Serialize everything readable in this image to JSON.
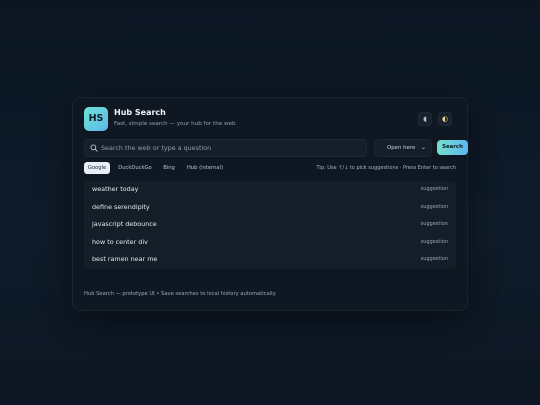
{
  "app": {
    "logo": "HS",
    "title": "Hub Search",
    "subtitle": "Fast, simple search — your hub for the web",
    "theme_buttons": [
      {
        "icon": "moon-icon",
        "glyph": "◖"
      },
      {
        "icon": "half-moon-icon",
        "glyph": "◐"
      }
    ]
  },
  "search": {
    "placeholder": "Search the web or type a question",
    "value": "",
    "open_mode": "Open here",
    "button_label": "Search"
  },
  "engines": [
    {
      "label": "Google",
      "active": true
    },
    {
      "label": "DuckDuckGo",
      "active": false
    },
    {
      "label": "Bing",
      "active": false
    },
    {
      "label": "Hub (internal)",
      "active": false
    }
  ],
  "tip": "Tip: Use ↑/↓ to pick suggestions · Press Enter to search",
  "suggestions": [
    {
      "text": "weather today",
      "tag": "suggestion"
    },
    {
      "text": "define serendipity",
      "tag": "suggestion"
    },
    {
      "text": "javascript debounce",
      "tag": "suggestion"
    },
    {
      "text": "how to center div",
      "tag": "suggestion"
    },
    {
      "text": "best ramen near me",
      "tag": "suggestion"
    }
  ],
  "footer": "Hub Search — prototype UI • Save searches to local history automatically.",
  "colors": {
    "background": "#0d1724",
    "card": "#0f1822",
    "accent_start": "#74e0c9",
    "accent_end": "#5eb8f0"
  }
}
